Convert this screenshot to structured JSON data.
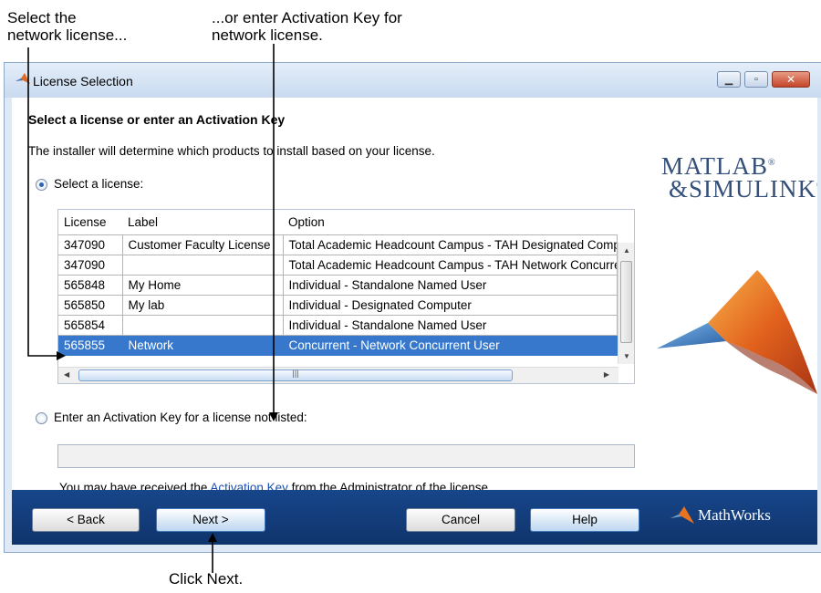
{
  "callouts": {
    "left": "Select the\nnetwork license...",
    "top": "...or enter Activation Key for\nnetwork license.",
    "bottom": "Click Next."
  },
  "window": {
    "title": "License Selection",
    "buttons": [
      "minimize",
      "maximize",
      "close"
    ]
  },
  "page": {
    "heading": "Select a license or enter an Activation Key",
    "description": "The installer will determine which products to install based on your license.",
    "select_option": {
      "label": "Select a license:",
      "checked": true
    },
    "enter_option": {
      "label": "Enter an Activation Key for a license not listed:",
      "checked": false
    },
    "activation_key_value": "",
    "note": {
      "before": "You may have received the ",
      "link": "Activation Key",
      "after": " from the Administrator of the license."
    }
  },
  "licenses": {
    "columns": [
      "License",
      "Label",
      "Option"
    ],
    "rows": [
      {
        "license": "347090",
        "label": "Customer Faculty License",
        "option": "Total Academic Headcount Campus - TAH Designated Computer"
      },
      {
        "license": "347090",
        "label": "",
        "option": "Total Academic Headcount Campus - TAH Network Concurrent User"
      },
      {
        "license": "565848",
        "label": "My Home",
        "option": "Individual - Standalone Named User"
      },
      {
        "license": "565850",
        "label": "My lab",
        "option": "Individual - Designated Computer"
      },
      {
        "license": "565854",
        "label": "",
        "option": "Individual - Standalone Named User"
      },
      {
        "license": "565855",
        "label": "Network",
        "option": "Concurrent - Network Concurrent User"
      }
    ],
    "selected_row": 5
  },
  "logo": {
    "line1": "MATLAB",
    "line2": "&SIMULINK",
    "reg": "®"
  },
  "footer": {
    "back": "< Back",
    "next": "Next >",
    "cancel": "Cancel",
    "help": "Help",
    "brand": "MathWorks"
  },
  "colors": {
    "footer_bg": "#17468a",
    "selection": "#3778cc",
    "link": "#1a4fb0"
  }
}
